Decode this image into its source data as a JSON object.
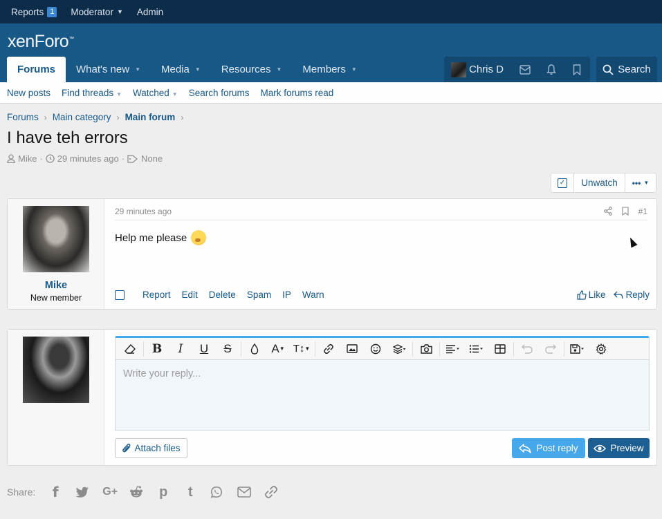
{
  "staffbar": {
    "reports_label": "Reports",
    "reports_count": "1",
    "moderator_label": "Moderator",
    "admin_label": "Admin"
  },
  "logo": {
    "text": "xenForo",
    "trademark": "™"
  },
  "nav": {
    "tabs": [
      {
        "label": "Forums",
        "active": true
      },
      {
        "label": "What's new",
        "active": false
      },
      {
        "label": "Media",
        "active": false
      },
      {
        "label": "Resources",
        "active": false
      },
      {
        "label": "Members",
        "active": false
      }
    ],
    "user_name": "Chris D",
    "search_label": "Search"
  },
  "subnav": {
    "items": [
      "New posts",
      "Find threads",
      "Watched",
      "Search forums",
      "Mark forums read"
    ]
  },
  "breadcrumb": {
    "items": [
      "Forums",
      "Main category",
      "Main forum"
    ]
  },
  "thread": {
    "title": "I have teh errors",
    "author": "Mike",
    "age": "29 minutes ago",
    "tags": "None",
    "unwatch_label": "Unwatch",
    "more_label": "•••"
  },
  "post": {
    "username": "Mike",
    "user_title": "New member",
    "time": "29 minutes ago",
    "number": "#1",
    "body": "Help me please",
    "actions": [
      "Report",
      "Edit",
      "Delete",
      "Spam",
      "IP",
      "Warn"
    ],
    "like_label": "Like",
    "reply_label": "Reply"
  },
  "editor": {
    "placeholder": "Write your reply...",
    "attach_label": "Attach files",
    "post_reply_label": "Post reply",
    "preview_label": "Preview",
    "bold_glyph": "B",
    "italic_glyph": "I",
    "underline_glyph": "U",
    "strike_glyph": "S",
    "font_color_glyph": "A",
    "font_size_glyph": "T↕"
  },
  "share": {
    "label": "Share:",
    "icons": [
      "facebook-icon",
      "twitter-icon",
      "google-plus-icon",
      "reddit-icon",
      "pinterest-icon",
      "tumblr-icon",
      "whatsapp-icon",
      "email-icon",
      "link-icon"
    ],
    "gplus_glyph": "G+",
    "facebook_glyph": "f",
    "pinterest_glyph": "p",
    "tumblr_glyph": "t"
  },
  "colors": {
    "staffbar_bg": "#0c2c4a",
    "header_bg": "#185886",
    "accent": "#47a7eb",
    "link": "#185886"
  }
}
